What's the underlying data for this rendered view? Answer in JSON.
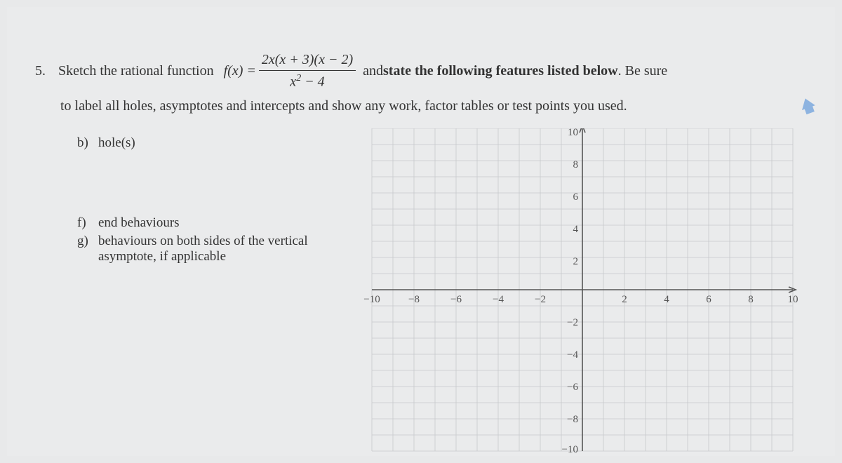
{
  "question": {
    "number": "5.",
    "text_before_fn": "Sketch the rational function",
    "fn_lhs": "f(x) =",
    "fn_numerator": "2x(x + 3)(x − 2)",
    "fn_denominator_base": "x",
    "fn_denominator_exp": "2",
    "fn_denominator_rest": " − 4",
    "text_after_fn_1": "and ",
    "text_bold": "state the following features listed below",
    "text_after_fn_2": ".  Be sure",
    "continuation": "to label all holes, asymptotes and intercepts and show any work, factor tables or test points you used."
  },
  "sub_questions": {
    "b_label": "b)",
    "b_text": "hole(s)",
    "f_label": "f)",
    "f_text": "end behaviours",
    "g_label": "g)",
    "g_text": "behaviours on both sides of the vertical asymptote, if applicable"
  },
  "chart_data": {
    "type": "scatter",
    "title": "",
    "xlabel": "",
    "ylabel": "",
    "xlim": [
      -10,
      10
    ],
    "ylim": [
      -10,
      10
    ],
    "x_ticks": [
      -10,
      -8,
      -6,
      -4,
      -2,
      2,
      4,
      6,
      8,
      10
    ],
    "y_ticks": [
      -10,
      -8,
      -6,
      -4,
      -2,
      2,
      4,
      6,
      8,
      10
    ],
    "series": []
  },
  "graph_labels": {
    "x": [
      "−10",
      "−8",
      "−6",
      "−4",
      "−2",
      "2",
      "4",
      "6",
      "8",
      "10"
    ],
    "y_pos": [
      "10",
      "8",
      "6",
      "4",
      "2"
    ],
    "y_neg": [
      "−2",
      "−4",
      "−6",
      "−8",
      "−10"
    ]
  }
}
